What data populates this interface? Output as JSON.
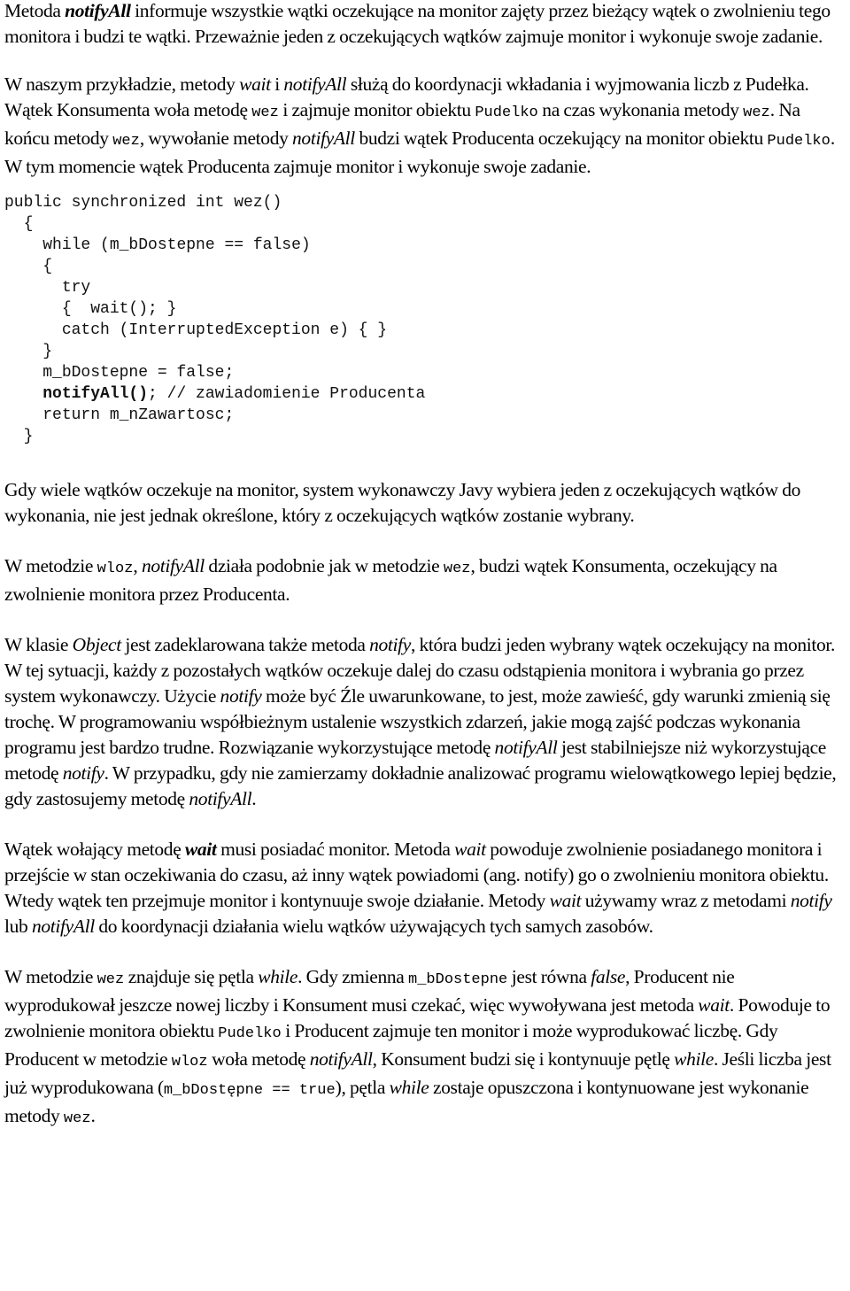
{
  "paragraphs": [
    {
      "id": "p1",
      "runs": [
        {
          "t": "Metoda ",
          "s": ""
        },
        {
          "t": "notifyAll",
          "s": "bi"
        },
        {
          "t": " informuje wszystkie wątki oczekujące na monitor zajęty przez bieżący wątek o zwolnieniu tego monitora i budzi te wątki. Przeważnie jeden z oczekujących wątków zajmuje monitor i wykonuje swoje zadanie.",
          "s": ""
        }
      ]
    },
    {
      "id": "p2",
      "runs": [
        {
          "t": "W naszym przykładzie, metody ",
          "s": ""
        },
        {
          "t": "wait",
          "s": "i"
        },
        {
          "t": " i ",
          "s": ""
        },
        {
          "t": "notifyAll",
          "s": "i"
        },
        {
          "t": " służą do koordynacji wkładania i wyjmowania liczb z Pudełka. Wątek Konsumenta woła metodę ",
          "s": ""
        },
        {
          "t": "wez",
          "s": "mono"
        },
        {
          "t": " i zajmuje monitor obiektu ",
          "s": ""
        },
        {
          "t": "Pudelko",
          "s": "mono"
        },
        {
          "t": " na czas wykonania metody ",
          "s": ""
        },
        {
          "t": "wez",
          "s": "mono"
        },
        {
          "t": ". Na końcu metody ",
          "s": ""
        },
        {
          "t": "wez",
          "s": "mono"
        },
        {
          "t": ", wywołanie metody ",
          "s": ""
        },
        {
          "t": "notifyAll",
          "s": "i"
        },
        {
          "t": " budzi wątek Producenta oczekujący na monitor obiektu ",
          "s": ""
        },
        {
          "t": "Pudelko",
          "s": "mono"
        },
        {
          "t": ". W tym momencie wątek Producenta zajmuje monitor i wykonuje swoje zadanie.",
          "s": ""
        }
      ]
    }
  ],
  "code_block": {
    "lines": [
      {
        "indent": "",
        "runs": [
          {
            "t": "public synchronized int wez()",
            "s": ""
          }
        ]
      },
      {
        "indent": "  ",
        "runs": [
          {
            "t": "{",
            "s": ""
          }
        ]
      },
      {
        "indent": "    ",
        "runs": [
          {
            "t": "while (m_bDostepne == false)",
            "s": ""
          }
        ]
      },
      {
        "indent": "    ",
        "runs": [
          {
            "t": "{",
            "s": ""
          }
        ]
      },
      {
        "indent": "      ",
        "runs": [
          {
            "t": "try",
            "s": ""
          }
        ]
      },
      {
        "indent": "      ",
        "runs": [
          {
            "t": "{  wait(); }",
            "s": ""
          }
        ]
      },
      {
        "indent": "      ",
        "runs": [
          {
            "t": "catch (InterruptedException e) { }",
            "s": ""
          }
        ]
      },
      {
        "indent": "    ",
        "runs": [
          {
            "t": "}",
            "s": ""
          }
        ]
      },
      {
        "indent": "    ",
        "runs": [
          {
            "t": "m_bDostepne = false;",
            "s": ""
          }
        ]
      },
      {
        "indent": "    ",
        "runs": [
          {
            "t": "notifyAll()",
            "s": "b"
          },
          {
            "t": "; // zawiadomienie Producenta",
            "s": ""
          }
        ]
      },
      {
        "indent": "    ",
        "runs": [
          {
            "t": "return m_nZawartosc;",
            "s": ""
          }
        ]
      },
      {
        "indent": "  ",
        "runs": [
          {
            "t": "}",
            "s": ""
          }
        ]
      }
    ]
  },
  "paragraphs_after": [
    {
      "id": "p3",
      "runs": [
        {
          "t": "Gdy wiele wątków oczekuje na monitor, system wykonawczy Javy wybiera jeden z oczekujących wątków do wykonania, nie jest jednak określone, który z oczekujących wątków zostanie wybrany.",
          "s": ""
        }
      ]
    },
    {
      "id": "p4",
      "runs": [
        {
          "t": "W metodzie ",
          "s": ""
        },
        {
          "t": "wloz",
          "s": "mono"
        },
        {
          "t": ", ",
          "s": ""
        },
        {
          "t": "notifyAll",
          "s": "i"
        },
        {
          "t": " działa podobnie jak w metodzie ",
          "s": ""
        },
        {
          "t": "wez",
          "s": "mono"
        },
        {
          "t": ", budzi wątek Konsumenta, oczekujący na zwolnienie monitora przez Producenta.",
          "s": ""
        }
      ]
    },
    {
      "id": "p5",
      "runs": [
        {
          "t": "W klasie ",
          "s": ""
        },
        {
          "t": "Object",
          "s": "i"
        },
        {
          "t": " jest zadeklarowana także metoda ",
          "s": ""
        },
        {
          "t": "notify",
          "s": "i"
        },
        {
          "t": ", która budzi jeden wybrany wątek oczekujący na monitor. W tej sytuacji, każdy z pozostałych wątków oczekuje dalej do czasu odstąpienia monitora i wybrania go przez system wykonawczy. Użycie ",
          "s": ""
        },
        {
          "t": "notify",
          "s": "i"
        },
        {
          "t": " może być Źle uwarunkowane, to jest, może zawieść, gdy warunki zmienią się trochę. W programowaniu współbieżnym ustalenie wszystkich zdarzeń, jakie mogą zajść podczas wykonania programu jest bardzo trudne. Rozwiązanie wykorzystujące metodę ",
          "s": ""
        },
        {
          "t": "notifyAll",
          "s": "i"
        },
        {
          "t": " jest stabilniejsze niż wykorzystujące metodę ",
          "s": ""
        },
        {
          "t": "notify",
          "s": "i"
        },
        {
          "t": ". W przypadku, gdy nie zamierzamy dokładnie analizować programu wielowątkowego lepiej będzie, gdy zastosujemy metodę ",
          "s": ""
        },
        {
          "t": "notifyAll",
          "s": "i"
        },
        {
          "t": ".",
          "s": ""
        }
      ]
    },
    {
      "id": "p6",
      "runs": [
        {
          "t": "Wątek wołający metodę ",
          "s": ""
        },
        {
          "t": "wait",
          "s": "bi"
        },
        {
          "t": " musi posiadać monitor. Metoda ",
          "s": ""
        },
        {
          "t": "wait",
          "s": "i"
        },
        {
          "t": " powoduje zwolnienie posiadanego monitora i przejście w stan oczekiwania do czasu, aż inny wątek powiadomi (ang. notify) go o zwolnieniu monitora obiektu. Wtedy wątek ten przejmuje monitor i kontynuuje swoje działanie. Metody ",
          "s": ""
        },
        {
          "t": "wait",
          "s": "i"
        },
        {
          "t": " używamy wraz z metodami ",
          "s": ""
        },
        {
          "t": "notify",
          "s": "i"
        },
        {
          "t": " lub ",
          "s": ""
        },
        {
          "t": "notifyAll",
          "s": "i"
        },
        {
          "t": " do koordynacji działania wielu wątków używających tych samych zasobów.",
          "s": ""
        }
      ]
    },
    {
      "id": "p7",
      "runs": [
        {
          "t": "W metodzie ",
          "s": ""
        },
        {
          "t": "wez",
          "s": "mono"
        },
        {
          "t": " znajduje się pętla ",
          "s": ""
        },
        {
          "t": "while",
          "s": "i"
        },
        {
          "t": ". Gdy zmienna ",
          "s": ""
        },
        {
          "t": "m_bDostepne",
          "s": "mono"
        },
        {
          "t": " jest równa ",
          "s": ""
        },
        {
          "t": "false",
          "s": "i"
        },
        {
          "t": ", Producent nie wyprodukował jeszcze nowej liczby i Konsument musi czekać, więc wywoływana jest metoda ",
          "s": ""
        },
        {
          "t": "wait",
          "s": "i"
        },
        {
          "t": ". Powoduje to zwolnienie monitora obiektu ",
          "s": ""
        },
        {
          "t": "Pudelko",
          "s": "mono"
        },
        {
          "t": " i Producent zajmuje ten monitor i może wyprodukować liczbę. Gdy Producent w metodzie ",
          "s": ""
        },
        {
          "t": "wloz",
          "s": "mono"
        },
        {
          "t": " woła metodę ",
          "s": ""
        },
        {
          "t": "notifyAll",
          "s": "i"
        },
        {
          "t": ", Konsument budzi się i kontynuuje pętlę ",
          "s": ""
        },
        {
          "t": "while",
          "s": "i"
        },
        {
          "t": ". Jeśli liczba jest już wyprodukowana (",
          "s": ""
        },
        {
          "t": "m_bDostępne == true",
          "s": "mono"
        },
        {
          "t": "), pętla ",
          "s": ""
        },
        {
          "t": "while",
          "s": "i"
        },
        {
          "t": " zostaje opuszczona i kontynuowane jest wykonanie metody ",
          "s": ""
        },
        {
          "t": "wez",
          "s": "mono"
        },
        {
          "t": ".",
          "s": ""
        }
      ]
    }
  ]
}
